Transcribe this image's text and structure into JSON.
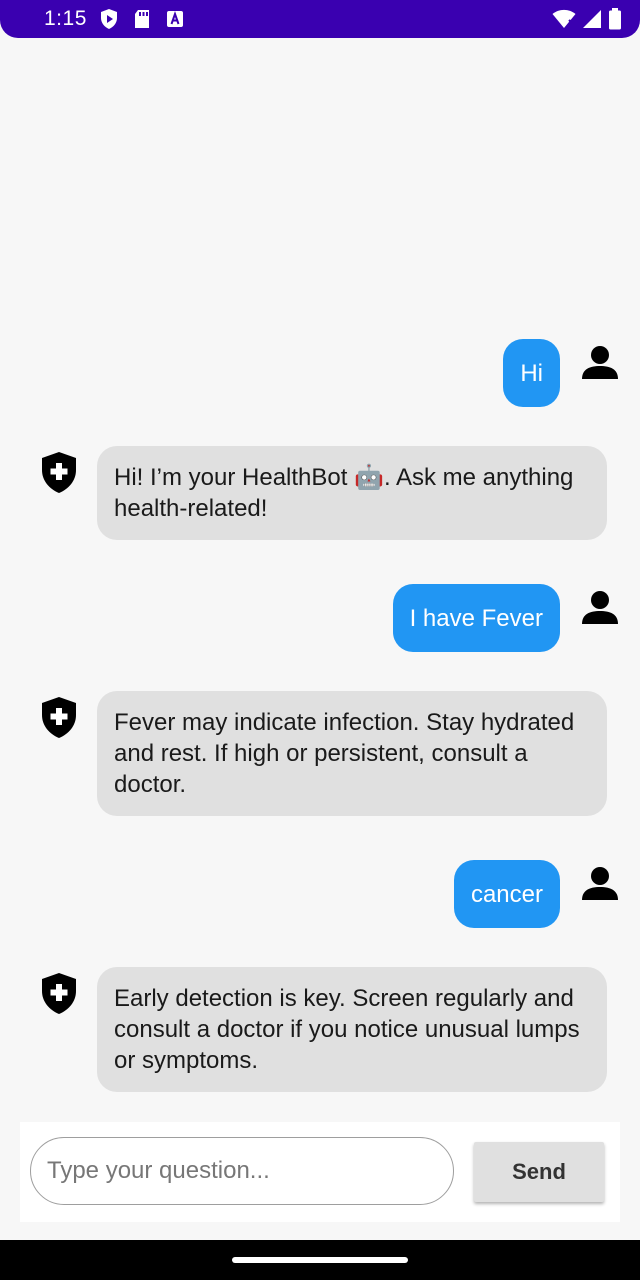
{
  "status_bar": {
    "time": "1:15",
    "left_icons": [
      "play-protect-icon",
      "sd-card-icon",
      "keyboard-a-icon"
    ],
    "right_icons": [
      "wifi-icon",
      "signal-icon",
      "battery-icon"
    ]
  },
  "colors": {
    "status_bar": "#3a00b0",
    "user_bubble": "#2196f3",
    "bot_bubble": "#e0e0e0",
    "background": "#f7f7f7"
  },
  "messages": [
    {
      "sender": "user",
      "text": "Hi",
      "icon": "person-icon"
    },
    {
      "sender": "bot",
      "text": "Hi! I’m your HealthBot 🤖. Ask me anything health-related!",
      "icon": "medical-shield-icon"
    },
    {
      "sender": "user",
      "text": "I have Fever",
      "icon": "person-icon"
    },
    {
      "sender": "bot",
      "text": "Fever may indicate infection. Stay hydrated and rest. If high or persistent, consult a doctor.",
      "icon": "medical-shield-icon"
    },
    {
      "sender": "user",
      "text": "cancer",
      "icon": "person-icon"
    },
    {
      "sender": "bot",
      "text": "Early detection is key. Screen regularly and consult a doctor if you notice unusual lumps or symptoms.",
      "icon": "medical-shield-icon"
    }
  ],
  "input": {
    "placeholder": "Type your question...",
    "value": "",
    "send_label": "Send"
  }
}
